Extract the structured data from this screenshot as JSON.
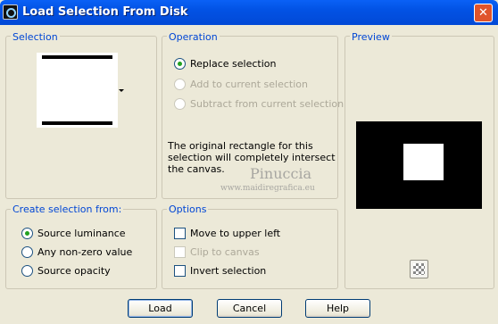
{
  "window": {
    "title": "Load Selection From Disk",
    "close_glyph": "✕"
  },
  "selection": {
    "legend": "Selection"
  },
  "operation": {
    "legend": "Operation",
    "options": [
      {
        "label": "Replace selection",
        "checked": true,
        "enabled": true
      },
      {
        "label": "Add to current selection",
        "checked": false,
        "enabled": false
      },
      {
        "label": "Subtract from current selection",
        "checked": false,
        "enabled": false
      }
    ],
    "info": "The original rectangle for this selection will completely intersect the canvas."
  },
  "preview": {
    "legend": "Preview"
  },
  "create_from": {
    "legend": "Create selection from:",
    "options": [
      {
        "label": "Source luminance",
        "checked": true
      },
      {
        "label": "Any non-zero value",
        "checked": false
      },
      {
        "label": "Source opacity",
        "checked": false
      }
    ]
  },
  "options": {
    "legend": "Options",
    "items": [
      {
        "label": "Move to upper left",
        "checked": false,
        "enabled": true
      },
      {
        "label": "Clip to canvas",
        "checked": false,
        "enabled": false
      },
      {
        "label": "Invert selection",
        "checked": false,
        "enabled": true
      }
    ]
  },
  "watermark": {
    "name": "Pinuccia",
    "url": "www.maidiregrafica.eu"
  },
  "buttons": {
    "load": "Load",
    "cancel": "Cancel",
    "help": "Help"
  }
}
